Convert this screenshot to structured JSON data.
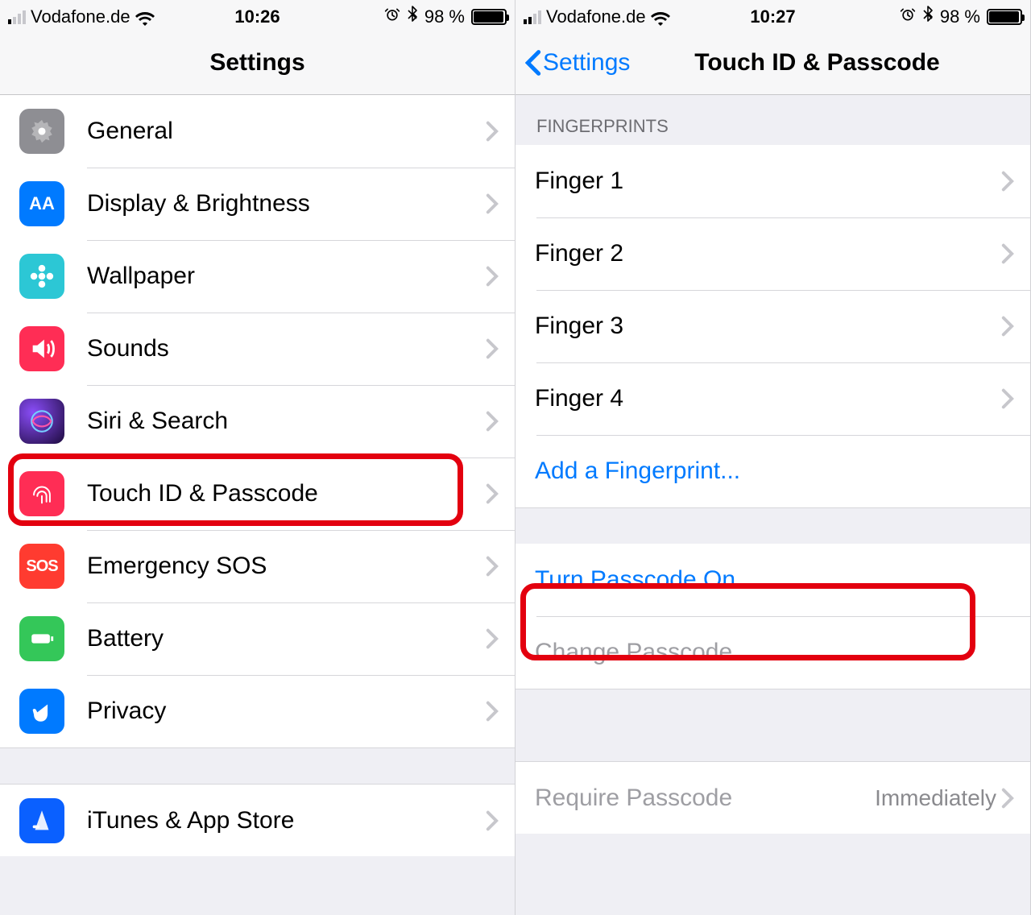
{
  "left": {
    "status": {
      "carrier": "Vodafone.de",
      "time": "10:26",
      "battery_pct": "98 %",
      "signal_bars_on": 1
    },
    "nav_title": "Settings",
    "items": [
      {
        "id": "general",
        "label": "General"
      },
      {
        "id": "display",
        "label": "Display & Brightness"
      },
      {
        "id": "wallpaper",
        "label": "Wallpaper"
      },
      {
        "id": "sounds",
        "label": "Sounds"
      },
      {
        "id": "siri",
        "label": "Siri & Search"
      },
      {
        "id": "touchid",
        "label": "Touch ID & Passcode"
      },
      {
        "id": "sos",
        "label": "Emergency SOS"
      },
      {
        "id": "battery",
        "label": "Battery"
      },
      {
        "id": "privacy",
        "label": "Privacy"
      },
      {
        "id": "itunes",
        "label": "iTunes & App Store"
      }
    ]
  },
  "right": {
    "status": {
      "carrier": "Vodafone.de",
      "time": "10:27",
      "battery_pct": "98 %",
      "signal_bars_on": 2
    },
    "back_label": "Settings",
    "nav_title": "Touch ID & Passcode",
    "fingerprints_header": "FINGERPRINTS",
    "fingers": [
      "Finger 1",
      "Finger 2",
      "Finger 3",
      "Finger 4"
    ],
    "add_fingerprint": "Add a Fingerprint...",
    "turn_on": "Turn Passcode On",
    "change": "Change Passcode",
    "require_label": "Require Passcode",
    "require_value": "Immediately"
  },
  "icons": {
    "alarm": "⏰",
    "bluetooth": "✱"
  }
}
